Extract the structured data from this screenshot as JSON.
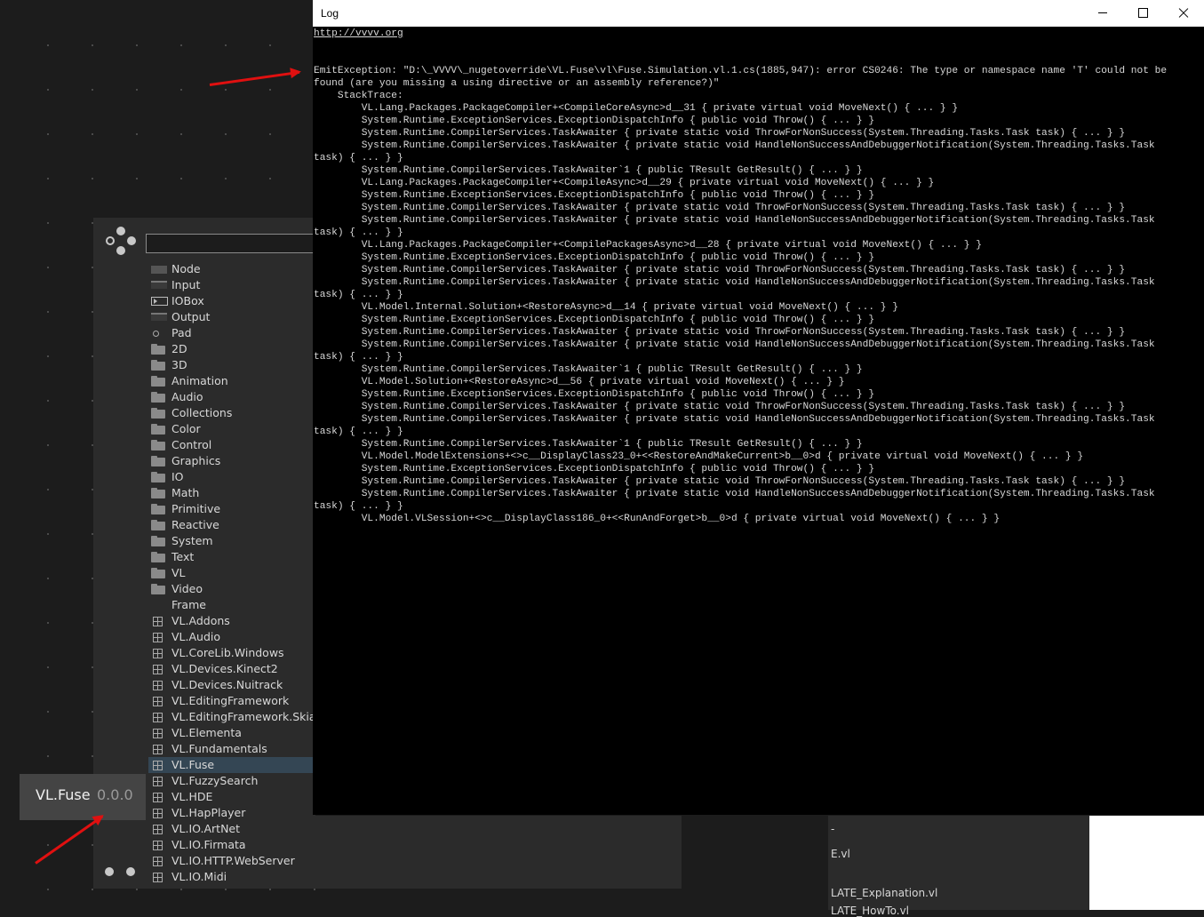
{
  "log_window": {
    "title": "Log",
    "link": "http://vvvv.org",
    "lines": [
      "",
      "",
      "EmitException: \"D:\\_VVVV\\_nugetoverride\\VL.Fuse\\vl\\Fuse.Simulation.vl.1.cs(1885,947): error CS0246: The type or namespace name 'T' could not be",
      "found (are you missing a using directive or an assembly reference?)\"",
      "    StackTrace:",
      "        VL.Lang.Packages.PackageCompiler+<CompileCoreAsync>d__31 { private virtual void MoveNext() { ... } }",
      "        System.Runtime.ExceptionServices.ExceptionDispatchInfo { public void Throw() { ... } }",
      "        System.Runtime.CompilerServices.TaskAwaiter { private static void ThrowForNonSuccess(System.Threading.Tasks.Task task) { ... } }",
      "        System.Runtime.CompilerServices.TaskAwaiter { private static void HandleNonSuccessAndDebuggerNotification(System.Threading.Tasks.Task",
      "task) { ... } }",
      "        System.Runtime.CompilerServices.TaskAwaiter`1 { public TResult GetResult() { ... } }",
      "        VL.Lang.Packages.PackageCompiler+<CompileAsync>d__29 { private virtual void MoveNext() { ... } }",
      "        System.Runtime.ExceptionServices.ExceptionDispatchInfo { public void Throw() { ... } }",
      "        System.Runtime.CompilerServices.TaskAwaiter { private static void ThrowForNonSuccess(System.Threading.Tasks.Task task) { ... } }",
      "        System.Runtime.CompilerServices.TaskAwaiter { private static void HandleNonSuccessAndDebuggerNotification(System.Threading.Tasks.Task",
      "task) { ... } }",
      "        VL.Lang.Packages.PackageCompiler+<CompilePackagesAsync>d__28 { private virtual void MoveNext() { ... } }",
      "        System.Runtime.ExceptionServices.ExceptionDispatchInfo { public void Throw() { ... } }",
      "        System.Runtime.CompilerServices.TaskAwaiter { private static void ThrowForNonSuccess(System.Threading.Tasks.Task task) { ... } }",
      "        System.Runtime.CompilerServices.TaskAwaiter { private static void HandleNonSuccessAndDebuggerNotification(System.Threading.Tasks.Task",
      "task) { ... } }",
      "        VL.Model.Internal.Solution+<RestoreAsync>d__14 { private virtual void MoveNext() { ... } }",
      "        System.Runtime.ExceptionServices.ExceptionDispatchInfo { public void Throw() { ... } }",
      "        System.Runtime.CompilerServices.TaskAwaiter { private static void ThrowForNonSuccess(System.Threading.Tasks.Task task) { ... } }",
      "        System.Runtime.CompilerServices.TaskAwaiter { private static void HandleNonSuccessAndDebuggerNotification(System.Threading.Tasks.Task",
      "task) { ... } }",
      "        System.Runtime.CompilerServices.TaskAwaiter`1 { public TResult GetResult() { ... } }",
      "        VL.Model.Solution+<RestoreAsync>d__56 { private virtual void MoveNext() { ... } }",
      "        System.Runtime.ExceptionServices.ExceptionDispatchInfo { public void Throw() { ... } }",
      "        System.Runtime.CompilerServices.TaskAwaiter { private static void ThrowForNonSuccess(System.Threading.Tasks.Task task) { ... } }",
      "        System.Runtime.CompilerServices.TaskAwaiter { private static void HandleNonSuccessAndDebuggerNotification(System.Threading.Tasks.Task",
      "task) { ... } }",
      "        System.Runtime.CompilerServices.TaskAwaiter`1 { public TResult GetResult() { ... } }",
      "        VL.Model.ModelExtensions+<>c__DisplayClass23_0+<<RestoreAndMakeCurrent>b__0>d { private virtual void MoveNext() { ... } }",
      "        System.Runtime.ExceptionServices.ExceptionDispatchInfo { public void Throw() { ... } }",
      "        System.Runtime.CompilerServices.TaskAwaiter { private static void ThrowForNonSuccess(System.Threading.Tasks.Task task) { ... } }",
      "        System.Runtime.CompilerServices.TaskAwaiter { private static void HandleNonSuccessAndDebuggerNotification(System.Threading.Tasks.Task",
      "task) { ... } }",
      "        VL.Model.VLSession+<>c__DisplayClass186_0+<<RunAndForget>b__0>d { private virtual void MoveNext() { ... } }"
    ]
  },
  "node_browser": {
    "search_value": "",
    "items": [
      {
        "label": "Node",
        "icon": "node-icon",
        "kind": "node"
      },
      {
        "label": "Input",
        "icon": "input-icon",
        "kind": "io"
      },
      {
        "label": "IOBox",
        "icon": "iobox-icon",
        "kind": "iobox"
      },
      {
        "label": "Output",
        "icon": "output-icon",
        "kind": "io"
      },
      {
        "label": "Pad",
        "icon": "pad-icon",
        "kind": "pad"
      },
      {
        "label": "2D",
        "icon": "folder-icon",
        "kind": "folder"
      },
      {
        "label": "3D",
        "icon": "folder-icon",
        "kind": "folder"
      },
      {
        "label": "Animation",
        "icon": "folder-icon",
        "kind": "folder"
      },
      {
        "label": "Audio",
        "icon": "folder-icon",
        "kind": "folder"
      },
      {
        "label": "Collections",
        "icon": "folder-icon",
        "kind": "folder"
      },
      {
        "label": "Color",
        "icon": "folder-icon",
        "kind": "folder"
      },
      {
        "label": "Control",
        "icon": "folder-icon",
        "kind": "folder"
      },
      {
        "label": "Graphics",
        "icon": "folder-icon",
        "kind": "folder"
      },
      {
        "label": "IO",
        "icon": "folder-icon",
        "kind": "folder"
      },
      {
        "label": "Math",
        "icon": "folder-icon",
        "kind": "folder"
      },
      {
        "label": "Primitive",
        "icon": "folder-icon",
        "kind": "folder"
      },
      {
        "label": "Reactive",
        "icon": "folder-icon",
        "kind": "folder"
      },
      {
        "label": "System",
        "icon": "folder-icon",
        "kind": "folder"
      },
      {
        "label": "Text",
        "icon": "folder-icon",
        "kind": "folder"
      },
      {
        "label": "VL",
        "icon": "folder-icon",
        "kind": "folder"
      },
      {
        "label": "Video",
        "icon": "folder-icon",
        "kind": "folder"
      },
      {
        "label": "Frame",
        "icon": "",
        "kind": "none"
      },
      {
        "label": "VL.Addons",
        "icon": "package-icon",
        "kind": "pkg"
      },
      {
        "label": "VL.Audio",
        "icon": "package-icon",
        "kind": "pkg"
      },
      {
        "label": "VL.CoreLib.Windows",
        "icon": "package-icon",
        "kind": "pkg"
      },
      {
        "label": "VL.Devices.Kinect2",
        "icon": "package-icon",
        "kind": "pkg"
      },
      {
        "label": "VL.Devices.Nuitrack",
        "icon": "package-icon",
        "kind": "pkg"
      },
      {
        "label": "VL.EditingFramework",
        "icon": "package-icon",
        "kind": "pkg"
      },
      {
        "label": "VL.EditingFramework.Skia",
        "icon": "package-icon",
        "kind": "pkg"
      },
      {
        "label": "VL.Elementa",
        "icon": "package-icon",
        "kind": "pkg"
      },
      {
        "label": "VL.Fundamentals",
        "icon": "package-icon",
        "kind": "pkg"
      },
      {
        "label": "VL.Fuse",
        "icon": "package-icon",
        "kind": "pkg",
        "selected": true
      },
      {
        "label": "VL.FuzzySearch",
        "icon": "package-icon",
        "kind": "pkg"
      },
      {
        "label": "VL.HDE",
        "icon": "package-icon",
        "kind": "pkg"
      },
      {
        "label": "VL.HapPlayer",
        "icon": "package-icon",
        "kind": "pkg"
      },
      {
        "label": "VL.IO.ArtNet",
        "icon": "package-icon",
        "kind": "pkg"
      },
      {
        "label": "VL.IO.Firmata",
        "icon": "package-icon",
        "kind": "pkg"
      },
      {
        "label": "VL.IO.HTTP.WebServer",
        "icon": "package-icon",
        "kind": "pkg"
      },
      {
        "label": "VL.IO.Midi",
        "icon": "package-icon",
        "kind": "pkg"
      }
    ]
  },
  "tooltip": {
    "name": "VL.Fuse",
    "version": "0.0.0"
  },
  "explorer": {
    "items": [
      "-",
      "E.vl",
      "LATE_Explanation.vl",
      "LATE_HowTo.vl"
    ]
  },
  "colors": {
    "annotation_arrow": "#e01010",
    "selection": "#344654"
  }
}
